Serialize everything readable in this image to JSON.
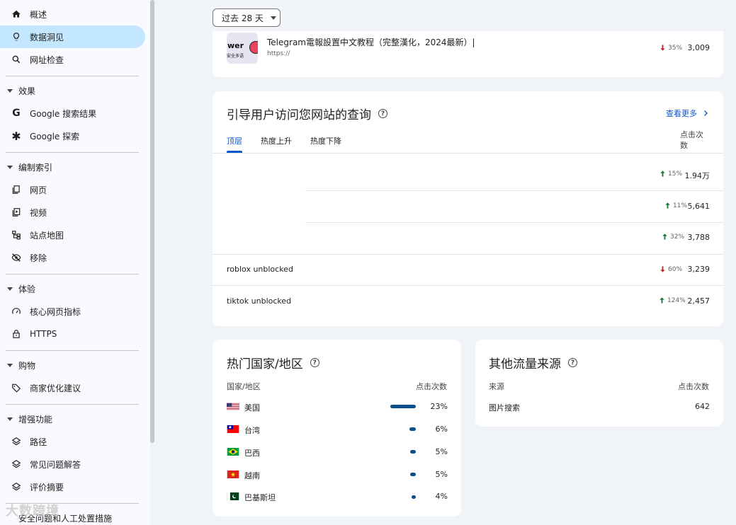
{
  "sidebar": {
    "top_items": [
      {
        "label": "概述",
        "icon": "home-icon"
      },
      {
        "label": "数据洞见",
        "icon": "lightbulb-icon"
      },
      {
        "label": "网址检查",
        "icon": "search-icon"
      }
    ],
    "sections": [
      {
        "title": "效果",
        "items": [
          {
            "label": "Google 搜索结果",
            "icon": "google-icon"
          },
          {
            "label": "Google 探索",
            "icon": "asterisk-icon"
          }
        ]
      },
      {
        "title": "编制索引",
        "items": [
          {
            "label": "网页",
            "icon": "pages-icon"
          },
          {
            "label": "视频",
            "icon": "video-icon"
          },
          {
            "label": "站点地图",
            "icon": "sitemap-icon"
          },
          {
            "label": "移除",
            "icon": "eye-off-icon"
          }
        ]
      },
      {
        "title": "体验",
        "items": [
          {
            "label": "核心网页指标",
            "icon": "gauge-icon"
          },
          {
            "label": "HTTPS",
            "icon": "lock-icon"
          }
        ]
      },
      {
        "title": "购物",
        "items": [
          {
            "label": "商家优化建议",
            "icon": "tag-icon"
          }
        ]
      },
      {
        "title": "增强功能",
        "items": [
          {
            "label": "路径",
            "icon": "layers-icon"
          },
          {
            "label": "常见问题解答",
            "icon": "layers-icon"
          },
          {
            "label": "评价摘要",
            "icon": "layers-icon"
          }
        ]
      }
    ],
    "bottom_item": "安全问题和人工处置措施"
  },
  "date_range": "过去 28 天",
  "top_page": {
    "thumb_text": "wer",
    "thumb_sub": "安全多语",
    "title": "Telegram電報設置中文教程（完整漢化，2024最新）|",
    "url": "https://",
    "trend": "35%",
    "trend_dir": "down",
    "clicks": "3,009"
  },
  "queries": {
    "title": "引导用户访问您网站的查询",
    "see_more": "查看更多",
    "tabs": [
      "顶层",
      "热度上升",
      "热度下降"
    ],
    "col_clicks": "点击次数",
    "rows": [
      {
        "query": "",
        "trend": "15%",
        "dir": "up",
        "clicks": "1.94万"
      },
      {
        "query": "",
        "trend": "11%",
        "dir": "up",
        "clicks": "5,641"
      },
      {
        "query": "",
        "trend": "32%",
        "dir": "up",
        "clicks": "3,788"
      },
      {
        "query": "roblox unblocked",
        "trend": "60%",
        "dir": "down",
        "clicks": "3,239"
      },
      {
        "query": "tiktok unblocked",
        "trend": "124%",
        "dir": "up",
        "clicks": "2,457"
      }
    ]
  },
  "countries": {
    "title": "热门国家/地区",
    "col_country": "国家/地区",
    "col_clicks": "点击次数",
    "rows": [
      {
        "name": "美国",
        "pct": "23%",
        "share": 23
      },
      {
        "name": "台湾",
        "pct": "6%",
        "share": 6
      },
      {
        "name": "巴西",
        "pct": "5%",
        "share": 5
      },
      {
        "name": "越南",
        "pct": "5%",
        "share": 5
      },
      {
        "name": "巴基斯坦",
        "pct": "4%",
        "share": 4
      }
    ]
  },
  "other_sources": {
    "title": "其他流量来源",
    "col_source": "来源",
    "col_clicks": "点击次数",
    "rows": [
      {
        "source": "图片搜索",
        "clicks": "642"
      }
    ]
  },
  "watermark": "大数跨境",
  "colors": {
    "accent": "#0b57d0",
    "active_bg": "#c2e7ff",
    "up": "#137333",
    "down": "#c5221f",
    "bar": "#0b4f8a"
  }
}
